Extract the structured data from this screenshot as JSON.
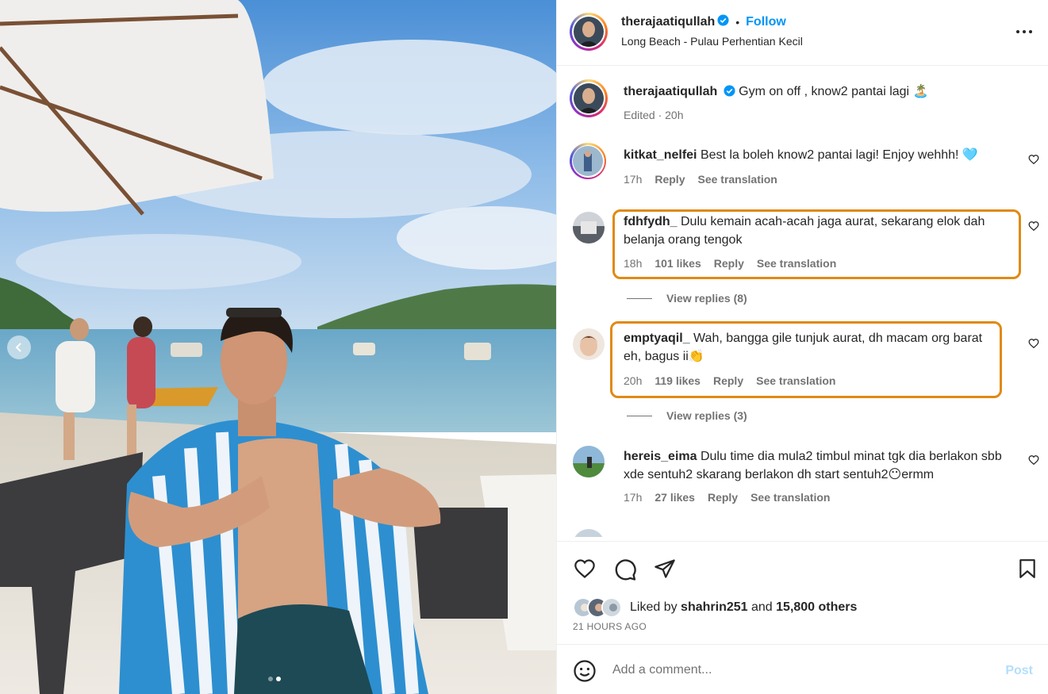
{
  "post": {
    "author": "therajaatiqullah",
    "follow_label": "Follow",
    "separator": "•",
    "location": "Long Beach - Pulau Perhentian Kecil",
    "more_icon": "more-horizontal-icon"
  },
  "caption": {
    "username": "therajaatiqullah",
    "text": "Gym on off , know2 pantai lagi 🏝️",
    "meta": "Edited · 20h"
  },
  "comments": [
    {
      "username": "kitkat_nelfei",
      "text": "Best la boleh know2 pantai lagi! Enjoy wehhh! 🩵",
      "time": "17h",
      "likes": "",
      "reply": "Reply",
      "translate": "See translation"
    },
    {
      "username": "fdhfydh_",
      "text": "Dulu kemain acah-acah jaga aurat, sekarang elok dah belanja orang tengok",
      "time": "18h",
      "likes": "101 likes",
      "reply": "Reply",
      "translate": "See translation",
      "view_replies": "View replies (8)"
    },
    {
      "username": "emptyaqil_",
      "text": "Wah, bangga gile tunjuk aurat, dh macam org barat eh, bagus ii👏",
      "time": "20h",
      "likes": "119 likes",
      "reply": "Reply",
      "translate": "See translation",
      "view_replies": "View replies (3)"
    },
    {
      "username": "hereis_eima",
      "text": "Dulu time dia mula2 timbul minat tgk dia berlakon sbb xde sentuh2 skarang berlakon dh start sentuh2😶ermm",
      "time": "17h",
      "likes": "27 likes",
      "reply": "Reply",
      "translate": "See translation"
    }
  ],
  "likes": {
    "prefix": "Liked by",
    "user": "shahrin251",
    "and": "and",
    "others": "15,800 others"
  },
  "time_ago": "21 HOURS AGO",
  "composer": {
    "placeholder": "Add a comment...",
    "post_label": "Post"
  },
  "colors": {
    "accent": "#0095f6",
    "highlight": "#e08a12",
    "muted": "#737373"
  }
}
